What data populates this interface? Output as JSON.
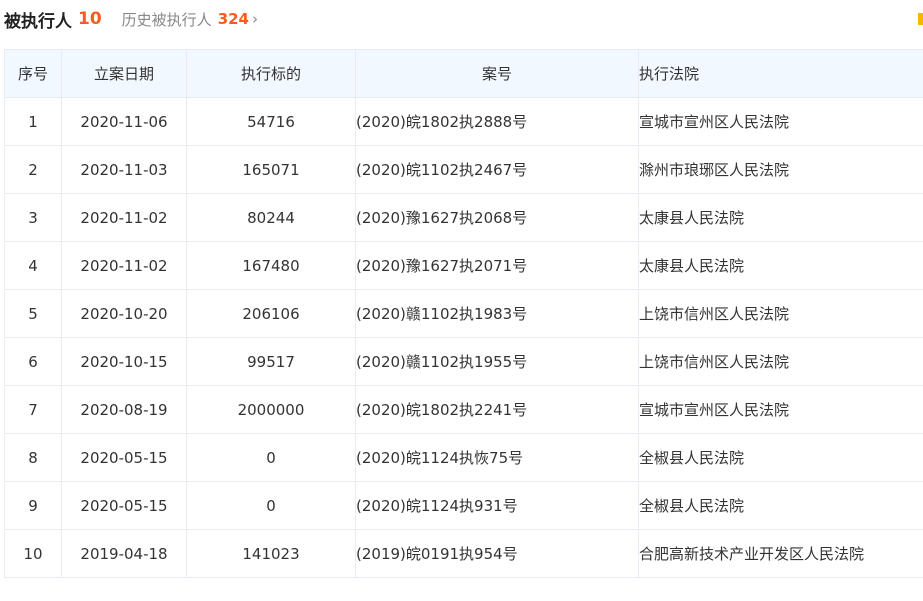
{
  "header": {
    "title": "被执行人",
    "count": "10",
    "history_label": "历史被执行人",
    "history_count": "324",
    "history_chevron_icon": "chevron-right-icon"
  },
  "table": {
    "columns": [
      "序号",
      "立案日期",
      "执行标的",
      "案号",
      "执行法院"
    ],
    "rows": [
      {
        "no": "1",
        "date": "2020-11-06",
        "amount": "54716",
        "case": "(2020)皖1802执2888号",
        "court": "宣城市宣州区人民法院"
      },
      {
        "no": "2",
        "date": "2020-11-03",
        "amount": "165071",
        "case": "(2020)皖1102执2467号",
        "court": "滁州市琅琊区人民法院"
      },
      {
        "no": "3",
        "date": "2020-11-02",
        "amount": "80244",
        "case": "(2020)豫1627执2068号",
        "court": "太康县人民法院"
      },
      {
        "no": "4",
        "date": "2020-11-02",
        "amount": "167480",
        "case": "(2020)豫1627执2071号",
        "court": "太康县人民法院"
      },
      {
        "no": "5",
        "date": "2020-10-20",
        "amount": "206106",
        "case": "(2020)赣1102执1983号",
        "court": "上饶市信州区人民法院"
      },
      {
        "no": "6",
        "date": "2020-10-15",
        "amount": "99517",
        "case": "(2020)赣1102执1955号",
        "court": "上饶市信州区人民法院"
      },
      {
        "no": "7",
        "date": "2020-08-19",
        "amount": "2000000",
        "case": "(2020)皖1802执2241号",
        "court": "宣城市宣州区人民法院"
      },
      {
        "no": "8",
        "date": "2020-05-15",
        "amount": "0",
        "case": "(2020)皖1124执恢75号",
        "court": "全椒县人民法院"
      },
      {
        "no": "9",
        "date": "2020-05-15",
        "amount": "0",
        "case": "(2020)皖1124执931号",
        "court": "全椒县人民法院"
      },
      {
        "no": "10",
        "date": "2019-04-18",
        "amount": "141023",
        "case": "(2019)皖0191执954号",
        "court": "合肥高新技术产业开发区人民法院"
      }
    ]
  },
  "colors": {
    "accent_count": "#fc5a1f",
    "header_bg": "#f2f8ff",
    "border": "#e8ecf2",
    "corner_mark": "#f5b800"
  }
}
